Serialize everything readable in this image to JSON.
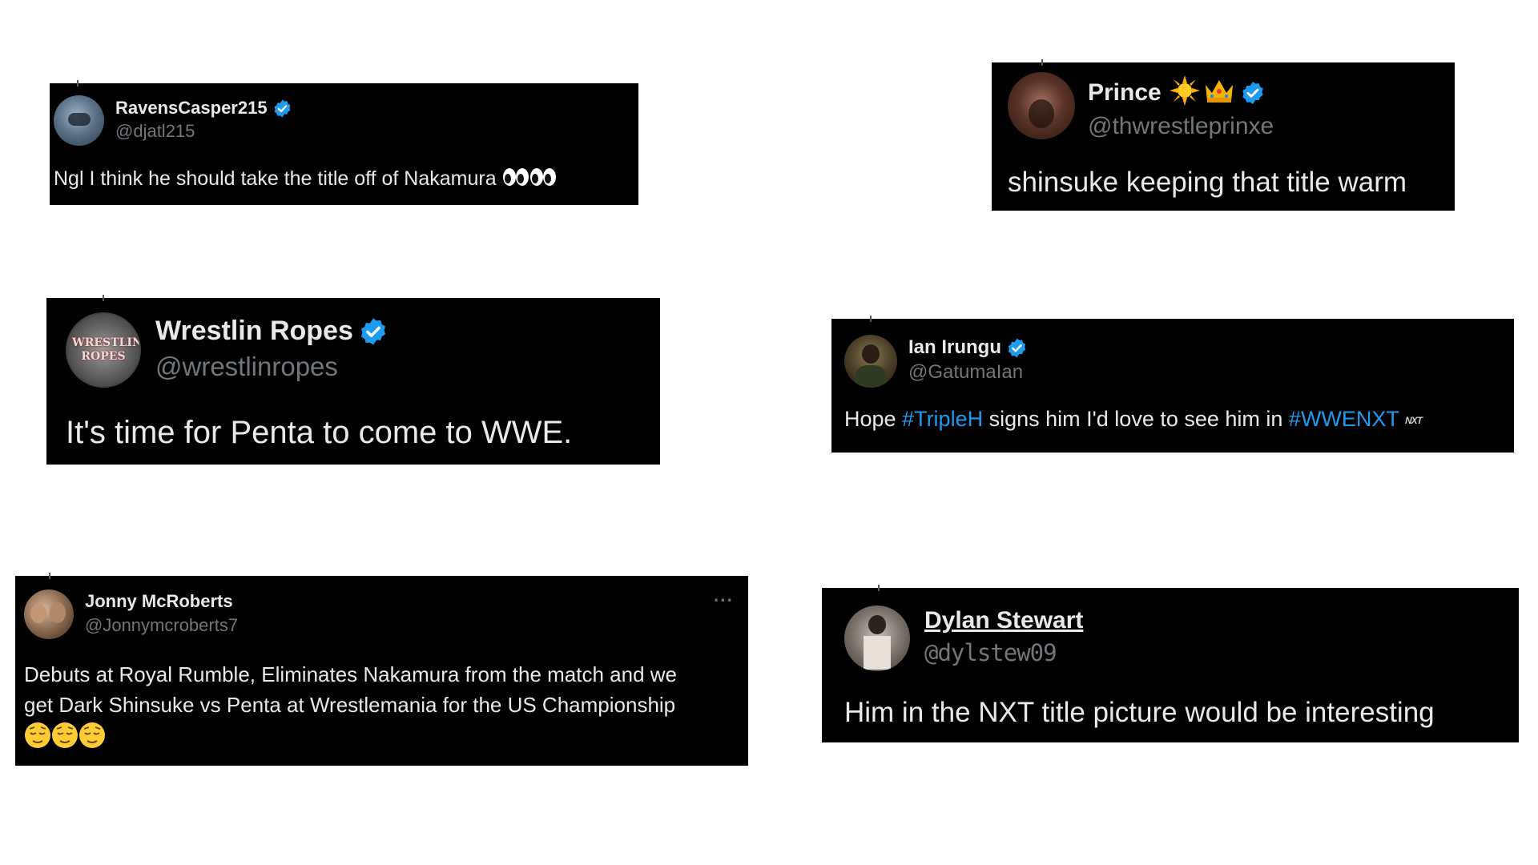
{
  "tweets": [
    {
      "id": "t1",
      "name": "RavensCasper215",
      "handle": "@djatl215",
      "verified": true,
      "text": "Ngl I think he should take the title off of Nakamura",
      "emojis": [
        "eyes",
        "eyes"
      ]
    },
    {
      "id": "t2",
      "name": "Prince",
      "name_emojis": [
        "sun",
        "crown"
      ],
      "handle": "@thwrestleprinxe",
      "verified": true,
      "text": "shinsuke keeping that title warm"
    },
    {
      "id": "t3",
      "name": "Wrestlin Ropes",
      "handle": "@wrestlinropes",
      "verified": true,
      "avatar_text": "WRESTLIN ROPES",
      "text": "It's time for Penta to come to WWE."
    },
    {
      "id": "t4",
      "name": "Ian Irungu",
      "handle": "@GatumaIan",
      "verified": true,
      "text_parts": [
        "Hope ",
        "#TripleH",
        " signs him I'd love to see him in ",
        "#WWENXT"
      ],
      "badge": "NXT"
    },
    {
      "id": "t5",
      "name": "Jonny McRoberts",
      "handle": "@Jonnymcroberts7",
      "verified": false,
      "more": "···",
      "text_line1": "Debuts at Royal Rumble, Eliminates Nakamura from the match and we",
      "text_line2": "get Dark Shinsuke vs Penta at Wrestlemania for the US Championship",
      "emojis": [
        "relieved",
        "relieved",
        "relieved"
      ]
    },
    {
      "id": "t6",
      "name": "Dylan Stewart",
      "handle": "@dylstew09",
      "verified": false,
      "text": "Him in the NXT title picture would be interesting"
    }
  ],
  "colors": {
    "card_bg": "#000000",
    "text": "#e7e9ea",
    "handle": "#71767b",
    "link": "#1d9bf0",
    "verified": "#1d9bf0",
    "page_bg": "#ffffff"
  }
}
